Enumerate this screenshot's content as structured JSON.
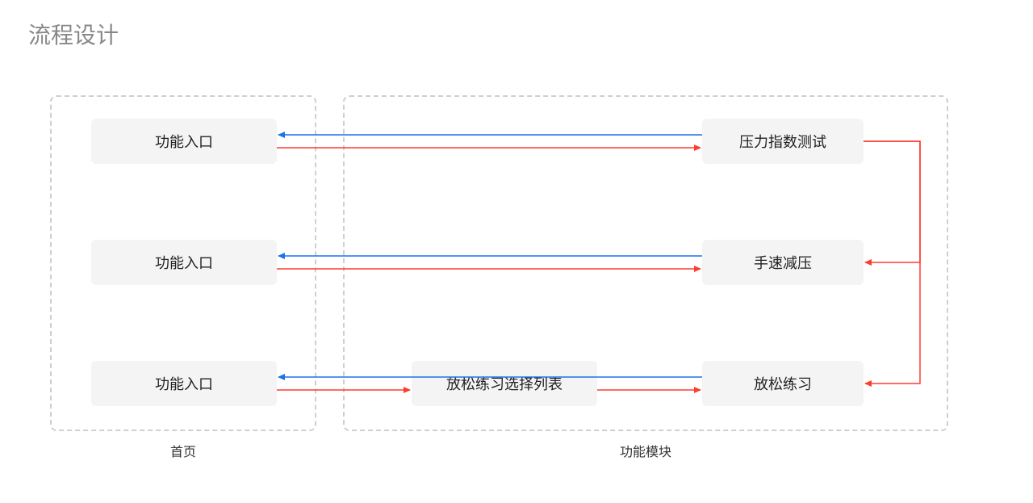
{
  "title": "流程设计",
  "groups": {
    "homepage": {
      "label": "首页"
    },
    "modules": {
      "label": "功能模块"
    }
  },
  "nodes": {
    "entry1": "功能入口",
    "entry2": "功能入口",
    "entry3": "功能入口",
    "stressTest": "压力指数测试",
    "speedRelief": "手速减压",
    "relaxList": "放松练习选择列表",
    "relaxPractice": "放松练习"
  },
  "colors": {
    "forward": "#ff3b30",
    "back": "#1a73e8",
    "groupBorder": "#cfcfcf",
    "nodeBg": "#f4f4f4"
  }
}
